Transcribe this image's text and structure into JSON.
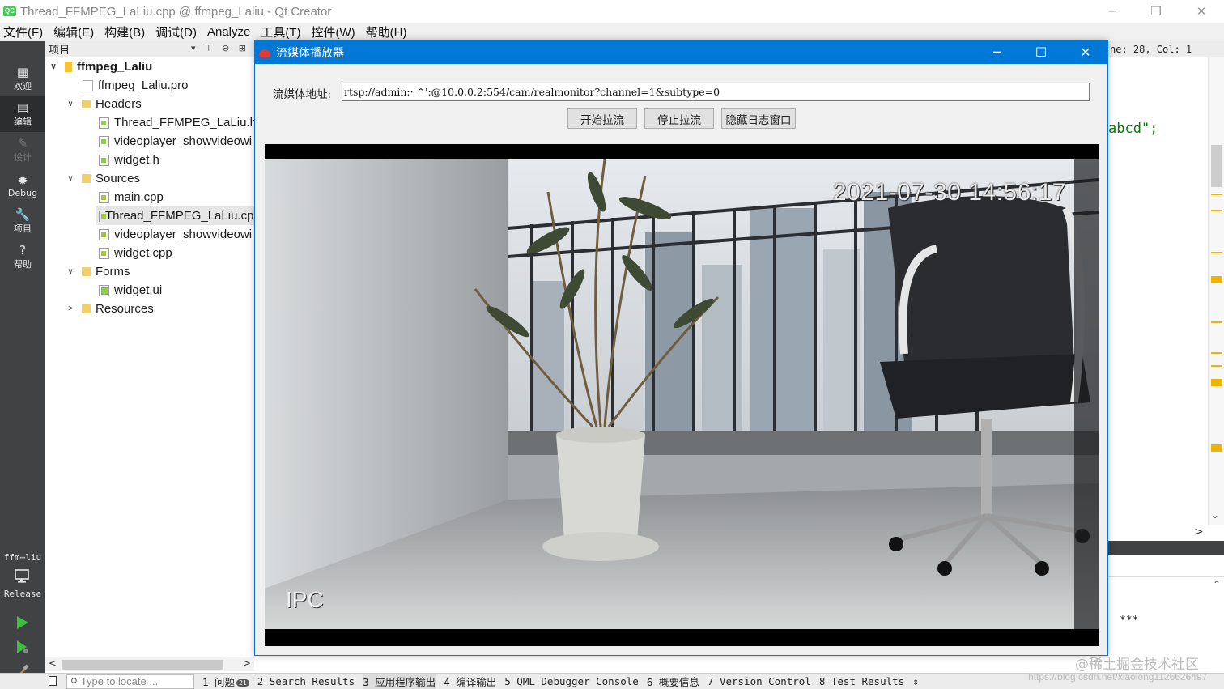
{
  "window": {
    "title": "Thread_FFMPEG_LaLiu.cpp @ ffmpeg_Laliu - Qt Creator",
    "logo_text": "QC",
    "controls": {
      "minimize": "─",
      "restore": "❐",
      "close": "✕"
    }
  },
  "menu": [
    "文件(F)",
    "编辑(E)",
    "构建(B)",
    "调试(D)",
    "Analyze",
    "工具(T)",
    "控件(W)",
    "帮助(H)"
  ],
  "modes": [
    {
      "icon": "▦",
      "label": "欢迎"
    },
    {
      "icon": "▤",
      "label": "编辑"
    },
    {
      "icon": "✎",
      "label": "设计"
    },
    {
      "icon": "✹",
      "label": "Debug"
    },
    {
      "icon": "🔧",
      "label": "项目"
    },
    {
      "icon": "?",
      "label": "帮助"
    }
  ],
  "kit": {
    "project": "ffm⋯liu",
    "config": "Release"
  },
  "project_panel": {
    "header": "项目",
    "header_icons": "▾ ⊤ ⊖ ⊞",
    "tree": [
      {
        "label": "ffmpeg_Laliu",
        "arrow": "∨",
        "icon": "proj"
      },
      {
        "label": "ffmpeg_Laliu.pro",
        "arrow": "",
        "icon": "pro"
      },
      {
        "label": "Headers",
        "arrow": "∨",
        "icon": "folder"
      },
      {
        "label": "Thread_FFMPEG_LaLiu.h",
        "arrow": "",
        "icon": "file"
      },
      {
        "label": "videoplayer_showvideowi",
        "arrow": "",
        "icon": "file"
      },
      {
        "label": "widget.h",
        "arrow": "",
        "icon": "file"
      },
      {
        "label": "Sources",
        "arrow": "∨",
        "icon": "folder"
      },
      {
        "label": "main.cpp",
        "arrow": "",
        "icon": "cpp"
      },
      {
        "label": "Thread_FFMPEG_LaLiu.cpp",
        "arrow": "",
        "icon": "cpp"
      },
      {
        "label": "videoplayer_showvideowi",
        "arrow": "",
        "icon": "cpp"
      },
      {
        "label": "widget.cpp",
        "arrow": "",
        "icon": "cpp"
      },
      {
        "label": "Forms",
        "arrow": "∨",
        "icon": "folder"
      },
      {
        "label": "widget.ui",
        "arrow": "",
        "icon": "ui"
      },
      {
        "label": "Resources",
        "arrow": ">",
        "icon": "folder"
      }
    ]
  },
  "editor": {
    "position": "ne: 28, Col: 1",
    "code_fragment": "abcd\";",
    "output_text": "***",
    "scroll_up": "⌃",
    "scroll_down": "⌄",
    "scroll_right": ">"
  },
  "statusbar": {
    "locate_placeholder": "Type to locate ...",
    "tabs": [
      {
        "label": "1 问题",
        "badge": "21"
      },
      {
        "label": "2 Search Results"
      },
      {
        "label": "3 应用程序输出"
      },
      {
        "label": "4 编译输出"
      },
      {
        "label": "5 QML Debugger Console"
      },
      {
        "label": "6 概要信息"
      },
      {
        "label": "7 Version Control"
      },
      {
        "label": "8 Test Results"
      }
    ],
    "more": "⇕"
  },
  "watermark": "@稀土掘金技术社区",
  "url_watermark": "https://blog.csdn.net/xiaolong1126626497",
  "player": {
    "title": "流媒体播放器",
    "address_label": "流媒体地址:",
    "address_value": "rtsp://admin:·          ^':@10.0.0.2:554/cam/realmonitor?channel=1&subtype=0",
    "buttons": {
      "start": "开始拉流",
      "stop": "停止拉流",
      "hide_log": "隐藏日志窗口"
    },
    "controls": {
      "minimize": "─",
      "maximize": "☐",
      "close": "✕"
    },
    "osd_timestamp": "2021-07-30 14:56:17",
    "osd_camera": "IPC"
  },
  "colors": {
    "accent": "#0078d7",
    "modebar": "#404244",
    "code_string": "#008000",
    "marker": "#f0b400"
  }
}
